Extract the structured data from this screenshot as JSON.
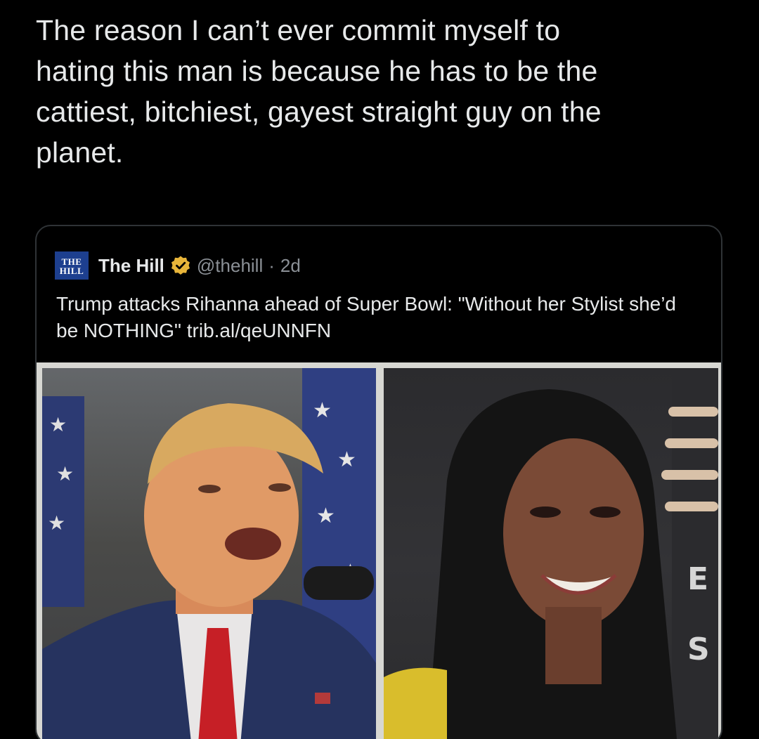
{
  "tweet": {
    "text": "The reason I can’t ever commit myself to\nhating this man is because he has to be the\ncattiest, bitchiest, gayest straight guy on the\nplanet."
  },
  "quoted_tweet": {
    "logo_text_top": "THE",
    "logo_text_bottom": "HILL",
    "source_name": "The Hill",
    "verified_icon": "verified-badge-icon",
    "handle": "@thehill",
    "separator": "·",
    "age": "2d",
    "text": "Trump attacks Rihanna ahead of Super Bowl: \"Without her Stylist she’d be NOTHING\" trib.al/qeUNNFN",
    "media": {
      "left_photo": "man-speaking-photo",
      "right_photo": "woman-smiling-photo"
    }
  },
  "colors": {
    "background": "#000000",
    "text_primary": "#e7e9ea",
    "text_secondary": "#8b9096",
    "card_border": "#2f3336",
    "verified_gold": "#e8b53a",
    "logo_blue": "#1d3f8f"
  }
}
